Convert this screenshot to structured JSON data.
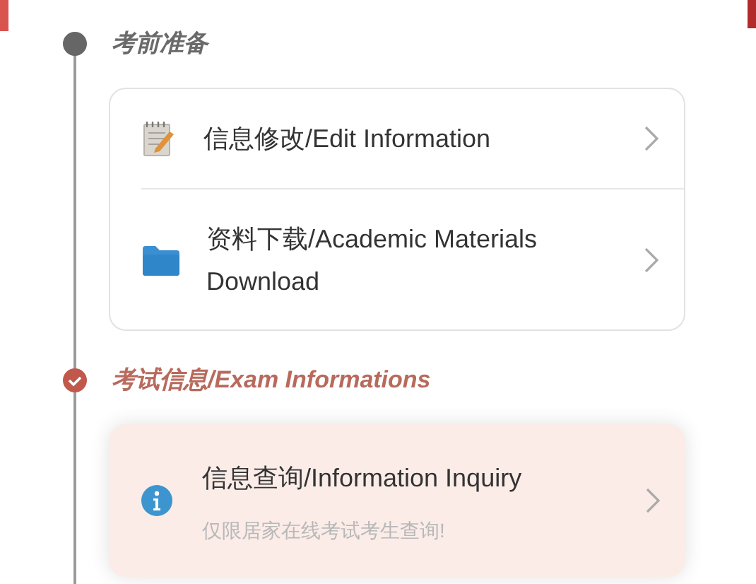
{
  "sections": [
    {
      "title": "考前准备",
      "completed": false,
      "highlighted": false,
      "items": [
        {
          "kind": "notepad",
          "title": "信息修改/Edit Information"
        },
        {
          "kind": "folder",
          "title": "资料下载/Academic Materials Download"
        }
      ]
    },
    {
      "title": "考试信息/Exam Informations",
      "completed": true,
      "highlighted": true,
      "items": [
        {
          "kind": "info",
          "title": "信息查询/Information Inquiry",
          "subtitle": "仅限居家在线考试考生查询!"
        }
      ]
    }
  ]
}
